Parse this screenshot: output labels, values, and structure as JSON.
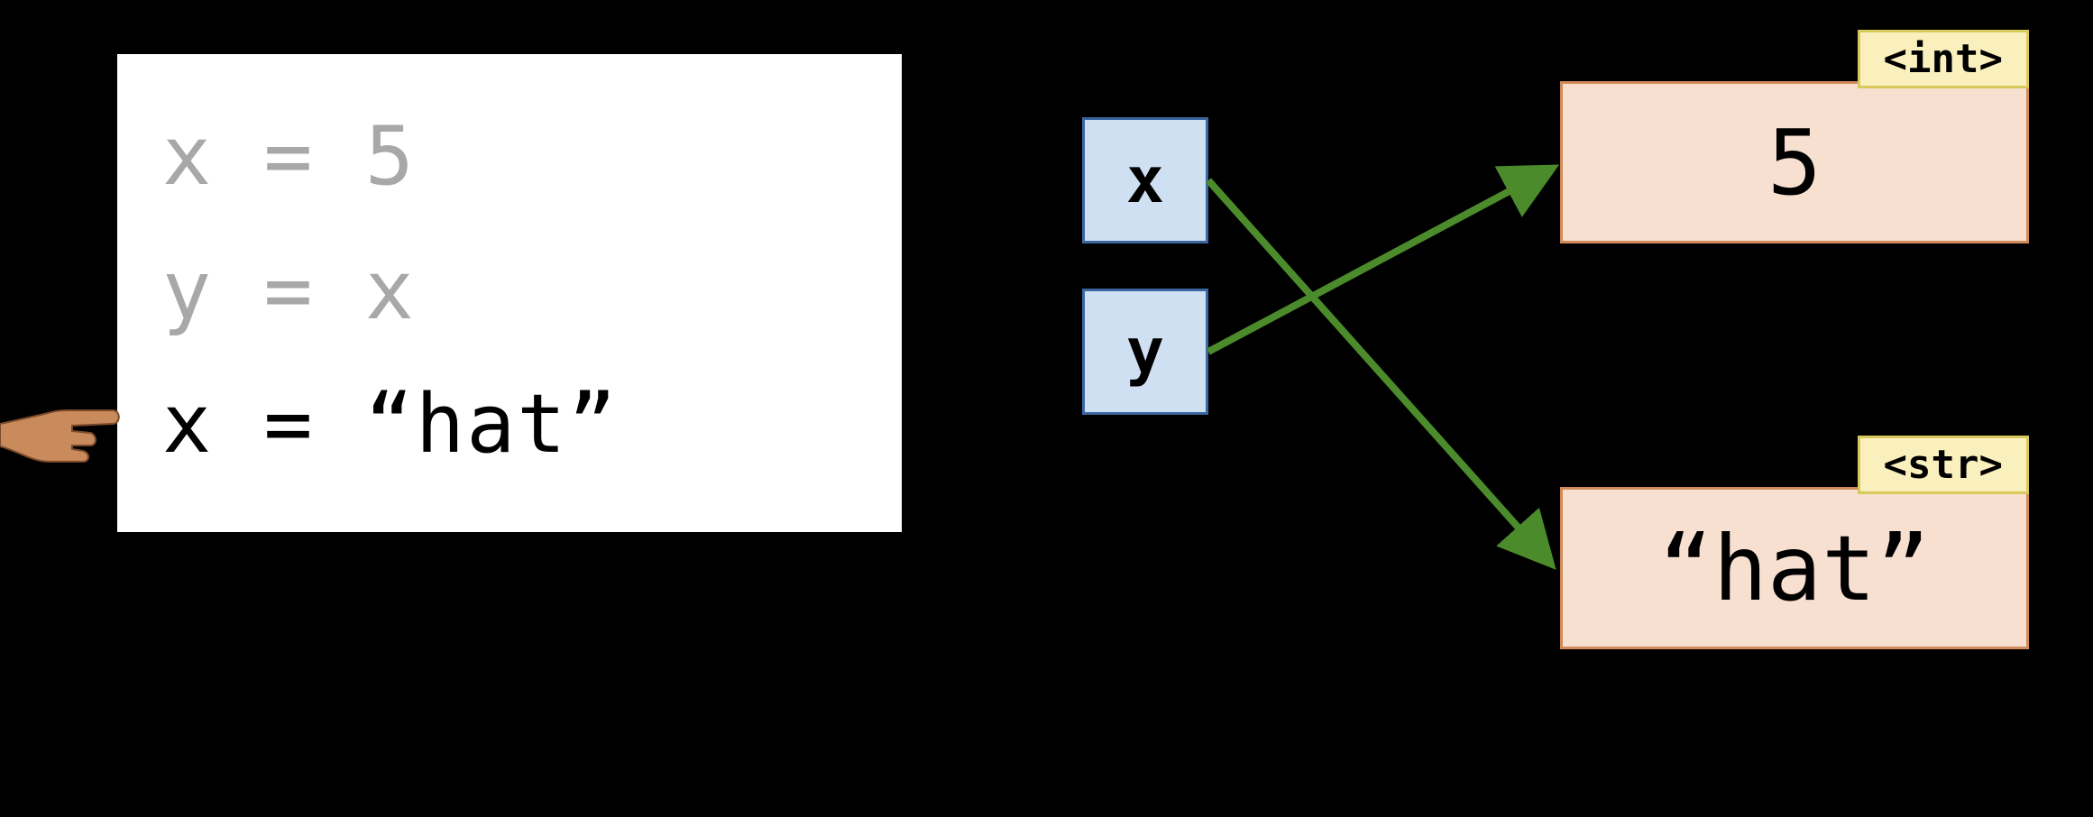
{
  "code": {
    "line1": "x = 5",
    "line2": "y = x",
    "line3": "x = “hat”"
  },
  "vars": {
    "x": "x",
    "y": "y"
  },
  "values": {
    "v1": "5",
    "v1_type": "<int>",
    "v2": "“hat”",
    "v2_type": "<str>"
  },
  "bindings": {
    "x_points_to": "v2",
    "y_points_to": "v1"
  },
  "colors": {
    "var_fill": "#cfe0f3",
    "var_border": "#3b679e",
    "val_fill": "#f8e0d0",
    "val_border": "#d18a5a",
    "type_fill": "#faf0bd",
    "type_border": "#d7c95b",
    "arrow": "#4c8b2b"
  }
}
